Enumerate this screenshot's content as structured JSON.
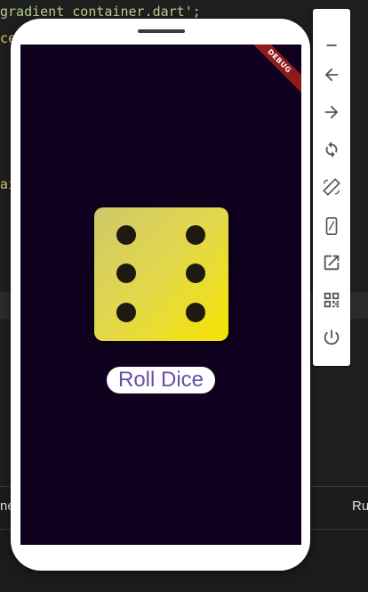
{
  "editor": {
    "line1_text": "gradient_container.dart';",
    "line2_text": "ce",
    "line3_text": "ai"
  },
  "bottom_panel": {
    "left_label": "ne",
    "right_label": "Ru"
  },
  "app": {
    "debug_banner": "DEBUG",
    "roll_button_label": "Roll Dice",
    "dice_value": 6
  },
  "toolbar": {
    "buttons": [
      "minimize-icon",
      "back-icon",
      "forward-icon",
      "rotate-icon",
      "screen-rotation-icon",
      "device-icon",
      "open-external-icon",
      "qr-code-icon",
      "power-icon"
    ]
  },
  "colors": {
    "screen_bg": "#10021f",
    "dice_gradient_start": "#cfc86a",
    "dice_gradient_end": "#f5e400",
    "button_text": "#6a4fa8",
    "debug_banner": "#8e1a1a"
  }
}
